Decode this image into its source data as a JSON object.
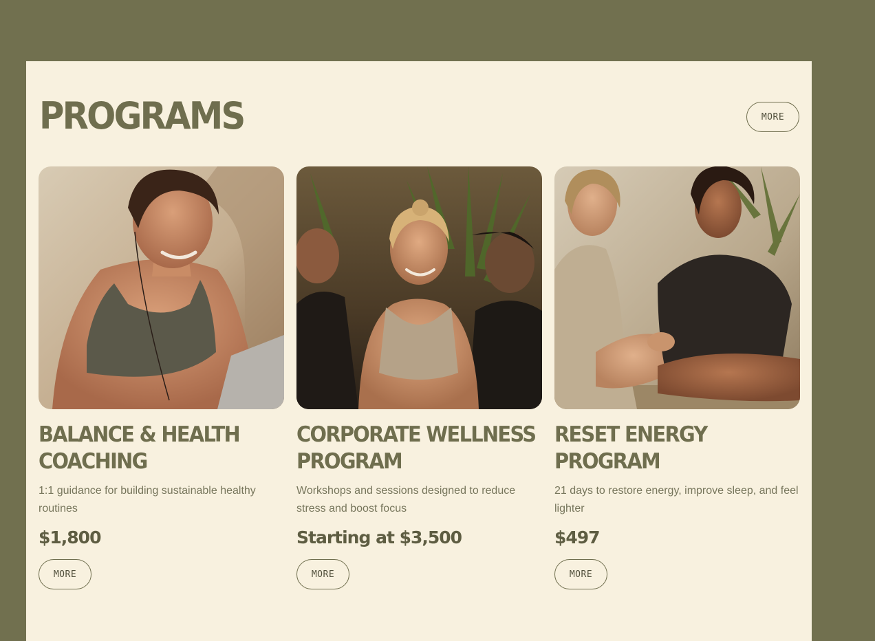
{
  "section": {
    "title": "PROGRAMS",
    "more_label": "MORE"
  },
  "programs": [
    {
      "title": "BALANCE & HEALTH COACHING",
      "description": "1:1 guidance for building sustainable healthy routines",
      "price": "$1,800",
      "more_label": "MORE"
    },
    {
      "title": "CORPORATE WELLNESS PROGRAM",
      "description": "Workshops and sessions designed to reduce stress and boost focus",
      "price": "Starting at $3,500",
      "more_label": "MORE"
    },
    {
      "title": "RESET ENERGY PROGRAM",
      "description": "21 days to restore energy, improve sleep, and feel lighter",
      "price": "$497",
      "more_label": "MORE"
    }
  ],
  "colors": {
    "page_background": "#71704f",
    "panel_background": "#f8f1df",
    "accent_olive": "#6f6e4e",
    "body_text": "#77765c"
  }
}
